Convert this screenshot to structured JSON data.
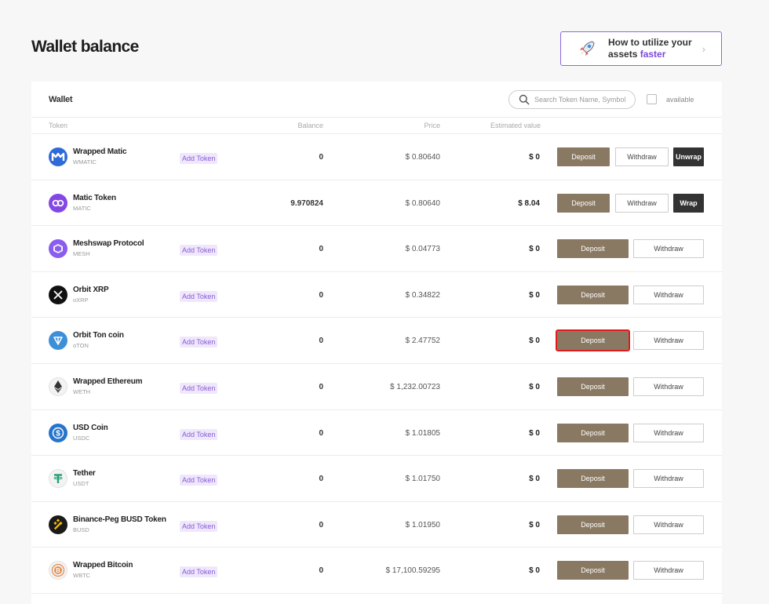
{
  "page_title": "Wallet balance",
  "promo": {
    "line1": "How to utilize your",
    "line2_prefix": "assets ",
    "line2_highlight": "faster"
  },
  "panel": {
    "title": "Wallet",
    "search_placeholder": "Search Token Name, Symbol",
    "available_label": "available"
  },
  "columns": {
    "token": "Token",
    "balance": "Balance",
    "price": "Price",
    "estimated": "Estimated value"
  },
  "labels": {
    "add_token": "Add Token",
    "deposit": "Deposit",
    "withdraw": "Withdraw",
    "unwrap": "Unwrap",
    "wrap": "Wrap"
  },
  "tokens": [
    {
      "name": "Wrapped Matic",
      "symbol": "WMATIC",
      "add_token": true,
      "balance": "0",
      "price": "$ 0.80640",
      "estimated": "$ 0",
      "extra": "Unwrap",
      "icon": "wmatic-icon",
      "color": "#2f6ad9"
    },
    {
      "name": "Matic Token",
      "symbol": "MATIC",
      "add_token": false,
      "balance": "9.970824",
      "price": "$ 0.80640",
      "estimated": "$ 8.04",
      "extra": "Wrap",
      "icon": "matic-icon",
      "color": "#8247e5"
    },
    {
      "name": "Meshswap Protocol",
      "symbol": "MESH",
      "add_token": true,
      "balance": "0",
      "price": "$ 0.04773",
      "estimated": "$ 0",
      "extra": "",
      "icon": "meshswap-icon",
      "color": "#8a5cf0"
    },
    {
      "name": "Orbit XRP",
      "symbol": "oXRP",
      "add_token": true,
      "balance": "0",
      "price": "$ 0.34822",
      "estimated": "$ 0",
      "extra": "",
      "icon": "xrp-icon",
      "color": "#111111"
    },
    {
      "name": "Orbit Ton coin",
      "symbol": "oTON",
      "add_token": true,
      "balance": "0",
      "price": "$ 2.47752",
      "estimated": "$ 0",
      "extra": "",
      "icon": "ton-icon",
      "color": "#3d8fd8"
    },
    {
      "name": "Wrapped Ethereum",
      "symbol": "WETH",
      "add_token": true,
      "balance": "0",
      "price": "$ 1,232.00723",
      "estimated": "$ 0",
      "extra": "",
      "icon": "ethereum-icon",
      "color": "#f3f3f3"
    },
    {
      "name": "USD Coin",
      "symbol": "USDC",
      "add_token": true,
      "balance": "0",
      "price": "$ 1.01805",
      "estimated": "$ 0",
      "extra": "",
      "icon": "usdc-icon",
      "color": "#2775ca"
    },
    {
      "name": "Tether",
      "symbol": "USDT",
      "add_token": true,
      "balance": "0",
      "price": "$ 1.01750",
      "estimated": "$ 0",
      "extra": "",
      "icon": "tether-icon",
      "color": "#f3f3f3"
    },
    {
      "name": "Binance-Peg BUSD Token",
      "symbol": "BUSD",
      "add_token": true,
      "balance": "0",
      "price": "$ 1.01950",
      "estimated": "$ 0",
      "extra": "",
      "icon": "busd-icon",
      "color": "#1a1a1a"
    },
    {
      "name": "Wrapped Bitcoin",
      "symbol": "WBTC",
      "add_token": true,
      "balance": "0",
      "price": "$ 17,100.59295",
      "estimated": "$ 0",
      "extra": "",
      "icon": "wbtc-icon",
      "color": "#f3f3f3"
    }
  ],
  "highlighted_row": 4,
  "colors": {
    "deposit": "#8a7962",
    "accent": "#7a48d8",
    "highlight": "#e01b1b"
  }
}
